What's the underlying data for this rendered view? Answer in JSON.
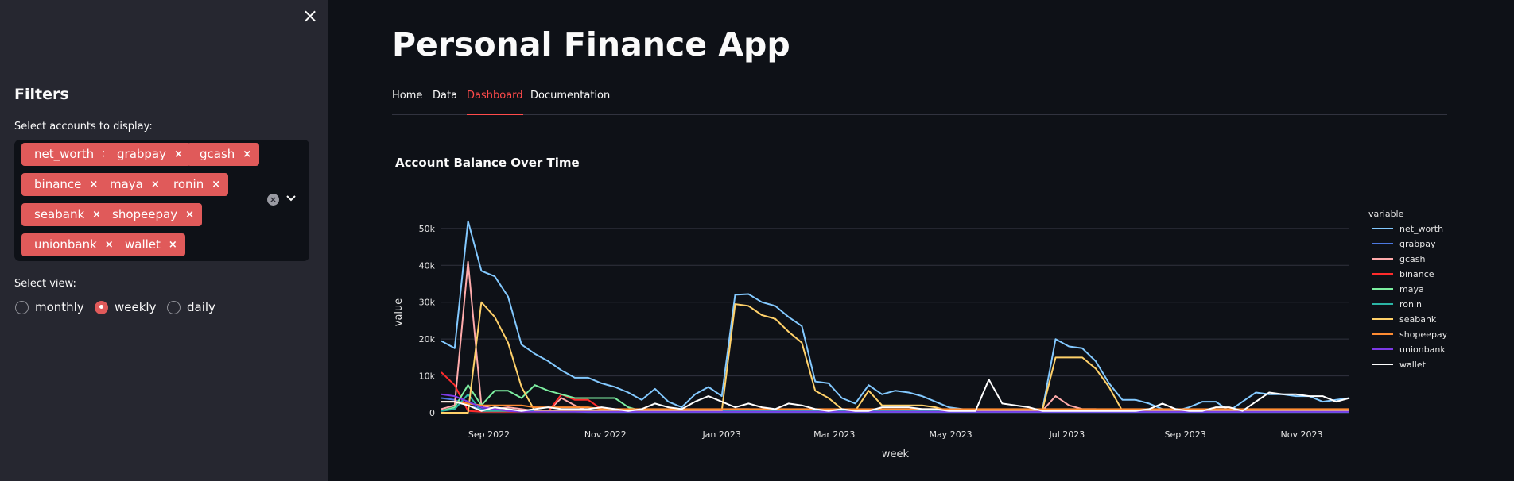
{
  "sidebar": {
    "close_label": "×",
    "filters_title": "Filters",
    "accounts_label": "Select accounts to display:",
    "selected_accounts": [
      "net_worth",
      "grabpay",
      "gcash",
      "binance",
      "maya",
      "ronin",
      "seabank",
      "shopeepay",
      "unionbank",
      "wallet"
    ],
    "tag_remove_label": "×",
    "clear_label": "×",
    "view_label": "Select view:",
    "view_options": [
      "monthly",
      "weekly",
      "daily"
    ],
    "view_selected": "weekly"
  },
  "main": {
    "title": "Personal Finance App",
    "tabs": [
      {
        "label": "Home",
        "active": false
      },
      {
        "label": "Data",
        "active": false
      },
      {
        "label": "Dashboard",
        "active": true
      },
      {
        "label": "Documentation",
        "active": false
      }
    ]
  },
  "colors": {
    "accent": "#ff4b4b",
    "tag": "#e05a5a",
    "sidebar_bg": "#262730",
    "main_bg": "#0e1117"
  },
  "chart_data": {
    "type": "line",
    "title": "Account Balance Over Time",
    "xlabel": "week",
    "ylabel": "value",
    "legend_title": "variable",
    "legend_position": "right",
    "grid": true,
    "x_start": "2022-08-07",
    "x_step_days": 7,
    "x_ticks": [
      {
        "date": "2022-09-01",
        "label": "Sep 2022"
      },
      {
        "date": "2022-11-01",
        "label": "Nov 2022"
      },
      {
        "date": "2023-01-01",
        "label": "Jan 2023"
      },
      {
        "date": "2023-03-01",
        "label": "Mar 2023"
      },
      {
        "date": "2023-05-01",
        "label": "May 2023"
      },
      {
        "date": "2023-07-01",
        "label": "Jul 2023"
      },
      {
        "date": "2023-09-01",
        "label": "Sep 2023"
      },
      {
        "date": "2023-11-01",
        "label": "Nov 2023"
      }
    ],
    "y_ticks": [
      {
        "value": 0,
        "label": "0"
      },
      {
        "value": 10000,
        "label": "10k"
      },
      {
        "value": 20000,
        "label": "20k"
      },
      {
        "value": 30000,
        "label": "30k"
      },
      {
        "value": 40000,
        "label": "40k"
      },
      {
        "value": 50000,
        "label": "50k"
      }
    ],
    "ylim": [
      -1500,
      56000
    ],
    "series": [
      {
        "name": "net_worth",
        "color": "#83c9ff",
        "values": [
          19500,
          17500,
          52000,
          38500,
          37000,
          31500,
          18500,
          16000,
          14000,
          11500,
          9500,
          9500,
          8000,
          7000,
          5500,
          3500,
          6500,
          3000,
          1500,
          5000,
          7000,
          4500,
          32000,
          32200,
          30000,
          29000,
          26000,
          23500,
          8500,
          8000,
          4000,
          2500,
          7500,
          5000,
          6000,
          5500,
          4500,
          3000,
          1500,
          1000,
          500,
          500,
          500,
          500,
          500,
          500,
          20000,
          18000,
          17500,
          14000,
          8000,
          3500,
          3500,
          2500,
          1000,
          500,
          1500,
          3000,
          3000,
          500,
          3000,
          5500,
          5000,
          5000,
          4500,
          4500,
          3000,
          3500,
          4000
        ]
      },
      {
        "name": "grabpay",
        "color": "#4c78e0",
        "values": [
          4000,
          3500,
          2000,
          1000,
          500,
          500,
          500,
          500,
          300,
          300,
          300,
          200,
          200,
          200,
          200,
          200,
          200,
          200,
          200,
          200,
          200,
          200,
          200,
          200,
          200,
          200,
          200,
          200,
          200,
          200,
          200,
          200,
          200,
          200,
          200,
          200,
          200,
          200,
          200,
          200,
          200,
          200,
          200,
          200,
          200,
          200,
          200,
          200,
          200,
          200,
          200,
          200,
          200,
          200,
          200,
          200,
          200,
          200,
          200,
          200,
          200,
          200,
          200,
          200,
          200,
          200,
          200,
          200,
          200
        ]
      },
      {
        "name": "gcash",
        "color": "#ffabab",
        "values": [
          1000,
          2000,
          41000,
          2000,
          1000,
          1500,
          1000,
          500,
          500,
          4000,
          2000,
          500,
          500,
          500,
          500,
          500,
          500,
          500,
          500,
          500,
          500,
          500,
          1000,
          1000,
          800,
          600,
          500,
          500,
          500,
          500,
          500,
          500,
          500,
          500,
          500,
          500,
          500,
          500,
          500,
          500,
          500,
          500,
          500,
          500,
          500,
          500,
          4500,
          2000,
          1000,
          1000,
          500,
          500,
          500,
          500,
          500,
          500,
          500,
          500,
          500,
          500,
          500,
          500,
          500,
          500,
          500,
          500,
          500,
          500,
          500
        ]
      },
      {
        "name": "binance",
        "color": "#ff2b2b",
        "values": [
          11000,
          7500,
          500,
          300,
          300,
          300,
          300,
          300,
          300,
          5000,
          3500,
          3500,
          1000,
          500,
          500,
          500,
          500,
          500,
          500,
          500,
          500,
          500,
          500,
          500,
          500,
          500,
          500,
          500,
          500,
          500,
          500,
          500,
          500,
          500,
          500,
          500,
          500,
          500,
          500,
          500,
          500,
          500,
          500,
          500,
          500,
          500,
          500,
          500,
          500,
          500,
          500,
          500,
          500,
          500,
          500,
          500,
          500,
          500,
          500,
          500,
          500,
          500,
          500,
          500,
          500,
          500,
          500,
          500,
          500
        ]
      },
      {
        "name": "maya",
        "color": "#7defa1",
        "values": [
          500,
          1500,
          7500,
          2000,
          6000,
          6000,
          4000,
          7500,
          6000,
          5000,
          4000,
          4000,
          4000,
          4000,
          1500,
          500,
          500,
          500,
          500,
          500,
          500,
          500,
          500,
          500,
          500,
          500,
          500,
          500,
          500,
          500,
          500,
          500,
          500,
          500,
          500,
          500,
          500,
          500,
          500,
          500,
          500,
          500,
          500,
          500,
          500,
          500,
          500,
          500,
          500,
          500,
          500,
          500,
          500,
          500,
          500,
          500,
          500,
          500,
          500,
          500,
          500,
          500,
          500,
          500,
          500,
          500,
          500,
          500,
          500
        ]
      },
      {
        "name": "ronin",
        "color": "#2bb5a5",
        "values": [
          500,
          1000,
          5000,
          500,
          500,
          500,
          500,
          500,
          500,
          500,
          500,
          500,
          500,
          500,
          500,
          500,
          500,
          500,
          500,
          500,
          500,
          500,
          500,
          500,
          500,
          500,
          500,
          500,
          500,
          500,
          500,
          500,
          500,
          500,
          500,
          500,
          500,
          500,
          500,
          500,
          500,
          500,
          500,
          500,
          500,
          500,
          500,
          500,
          500,
          500,
          500,
          500,
          500,
          500,
          500,
          500,
          500,
          500,
          500,
          500,
          500,
          500,
          500,
          500,
          500,
          500,
          500,
          500,
          500
        ]
      },
      {
        "name": "seabank",
        "color": "#ffd16a",
        "values": [
          0,
          0,
          0,
          30000,
          26000,
          19000,
          7000,
          500,
          500,
          500,
          500,
          500,
          500,
          500,
          500,
          500,
          500,
          500,
          500,
          500,
          500,
          500,
          29500,
          29000,
          26500,
          25500,
          22000,
          19000,
          6000,
          4000,
          1000,
          500,
          6000,
          2000,
          2000,
          2000,
          2000,
          1500,
          500,
          500,
          500,
          500,
          500,
          500,
          500,
          500,
          15000,
          15000,
          15000,
          12000,
          7000,
          500,
          500,
          500,
          500,
          500,
          500,
          500,
          500,
          500,
          500,
          500,
          500,
          500,
          500,
          500,
          500,
          500,
          500
        ]
      },
      {
        "name": "shopeepay",
        "color": "#ff8c32",
        "values": [
          3000,
          3000,
          2500,
          2000,
          2000,
          2000,
          2000,
          1500,
          1500,
          1500,
          1500,
          1500,
          1000,
          1000,
          1000,
          1000,
          1000,
          1000,
          1000,
          1000,
          1000,
          1000,
          1000,
          1000,
          1000,
          1000,
          1000,
          1000,
          1000,
          1000,
          1000,
          1000,
          1000,
          1000,
          1000,
          1000,
          1000,
          1000,
          1000,
          1000,
          1000,
          1000,
          1000,
          1000,
          1000,
          1000,
          1000,
          1000,
          1000,
          1000,
          1000,
          1000,
          1000,
          1000,
          1000,
          1000,
          1000,
          1000,
          1000,
          1000,
          1000,
          1000,
          1000,
          1000,
          1000,
          1000,
          1000,
          1000,
          1000
        ]
      },
      {
        "name": "unionbank",
        "color": "#7c3ae6",
        "values": [
          5000,
          4500,
          3000,
          1500,
          1000,
          500,
          300,
          300,
          300,
          300,
          300,
          300,
          300,
          300,
          300,
          300,
          300,
          300,
          300,
          300,
          300,
          300,
          300,
          300,
          300,
          300,
          300,
          300,
          300,
          300,
          300,
          300,
          300,
          300,
          300,
          300,
          300,
          300,
          300,
          300,
          300,
          300,
          300,
          300,
          300,
          300,
          300,
          300,
          300,
          300,
          300,
          300,
          300,
          300,
          300,
          300,
          300,
          300,
          300,
          300,
          300,
          300,
          300,
          300,
          300,
          300,
          300,
          300,
          300
        ]
      },
      {
        "name": "wallet",
        "color": "#ffffff",
        "values": [
          3000,
          3000,
          2000,
          500,
          1500,
          1000,
          500,
          1000,
          1500,
          1000,
          1000,
          1000,
          1500,
          1000,
          500,
          1000,
          2500,
          1500,
          1000,
          3000,
          4500,
          3000,
          1500,
          2500,
          1500,
          1000,
          2500,
          2000,
          1000,
          500,
          1000,
          500,
          500,
          1500,
          1500,
          1500,
          1000,
          1000,
          500,
          500,
          500,
          9000,
          2500,
          2000,
          1500,
          500,
          500,
          500,
          500,
          500,
          500,
          500,
          500,
          1000,
          2500,
          1000,
          500,
          500,
          1500,
          1500,
          500,
          3000,
          5500,
          5000,
          5000,
          4500,
          4500,
          3000,
          4000
        ]
      }
    ]
  }
}
